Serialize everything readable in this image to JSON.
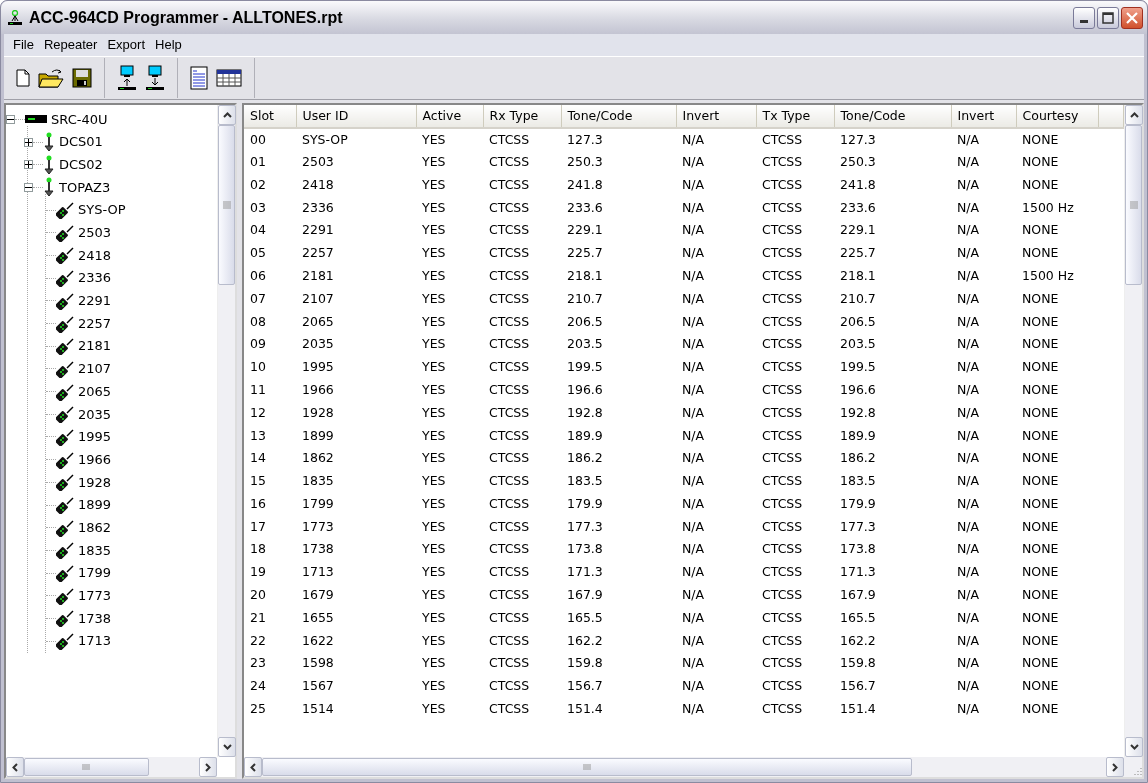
{
  "window": {
    "title": "ACC-964CD Programmer - ALLTONES.rpt"
  },
  "menu": [
    "File",
    "Repeater",
    "Export",
    "Help"
  ],
  "tree": [
    {
      "label": "SRC-40U",
      "kind": "controller",
      "expanded": true,
      "children": [
        {
          "label": "DCS01",
          "kind": "repeater",
          "expanded": false
        },
        {
          "label": "DCS02",
          "kind": "repeater",
          "expanded": false
        },
        {
          "label": "TOPAZ3",
          "kind": "repeater",
          "expanded": true,
          "children": [
            {
              "label": "SYS-OP",
              "kind": "radio"
            },
            {
              "label": "2503",
              "kind": "radio"
            },
            {
              "label": "2418",
              "kind": "radio"
            },
            {
              "label": "2336",
              "kind": "radio"
            },
            {
              "label": "2291",
              "kind": "radio"
            },
            {
              "label": "2257",
              "kind": "radio"
            },
            {
              "label": "2181",
              "kind": "radio"
            },
            {
              "label": "2107",
              "kind": "radio"
            },
            {
              "label": "2065",
              "kind": "radio"
            },
            {
              "label": "2035",
              "kind": "radio"
            },
            {
              "label": "1995",
              "kind": "radio"
            },
            {
              "label": "1966",
              "kind": "radio"
            },
            {
              "label": "1928",
              "kind": "radio"
            },
            {
              "label": "1899",
              "kind": "radio"
            },
            {
              "label": "1862",
              "kind": "radio"
            },
            {
              "label": "1835",
              "kind": "radio"
            },
            {
              "label": "1799",
              "kind": "radio"
            },
            {
              "label": "1773",
              "kind": "radio"
            },
            {
              "label": "1738",
              "kind": "radio"
            },
            {
              "label": "1713",
              "kind": "radio"
            }
          ]
        }
      ]
    }
  ],
  "table": {
    "columns": [
      "Slot",
      "User ID",
      "Active",
      "Rx Type",
      "Tone/Code",
      "Invert",
      "Tx Type",
      "Tone/Code",
      "Invert",
      "Courtesy"
    ],
    "rows": [
      [
        "00",
        "SYS-OP",
        "YES",
        "CTCSS",
        "127.3",
        "N/A",
        "CTCSS",
        "127.3",
        "N/A",
        "NONE"
      ],
      [
        "01",
        "2503",
        "YES",
        "CTCSS",
        "250.3",
        "N/A",
        "CTCSS",
        "250.3",
        "N/A",
        "NONE"
      ],
      [
        "02",
        "2418",
        "YES",
        "CTCSS",
        "241.8",
        "N/A",
        "CTCSS",
        "241.8",
        "N/A",
        "NONE"
      ],
      [
        "03",
        "2336",
        "YES",
        "CTCSS",
        "233.6",
        "N/A",
        "CTCSS",
        "233.6",
        "N/A",
        "1500 Hz"
      ],
      [
        "04",
        "2291",
        "YES",
        "CTCSS",
        "229.1",
        "N/A",
        "CTCSS",
        "229.1",
        "N/A",
        "NONE"
      ],
      [
        "05",
        "2257",
        "YES",
        "CTCSS",
        "225.7",
        "N/A",
        "CTCSS",
        "225.7",
        "N/A",
        "NONE"
      ],
      [
        "06",
        "2181",
        "YES",
        "CTCSS",
        "218.1",
        "N/A",
        "CTCSS",
        "218.1",
        "N/A",
        "1500 Hz"
      ],
      [
        "07",
        "2107",
        "YES",
        "CTCSS",
        "210.7",
        "N/A",
        "CTCSS",
        "210.7",
        "N/A",
        "NONE"
      ],
      [
        "08",
        "2065",
        "YES",
        "CTCSS",
        "206.5",
        "N/A",
        "CTCSS",
        "206.5",
        "N/A",
        "NONE"
      ],
      [
        "09",
        "2035",
        "YES",
        "CTCSS",
        "203.5",
        "N/A",
        "CTCSS",
        "203.5",
        "N/A",
        "NONE"
      ],
      [
        "10",
        "1995",
        "YES",
        "CTCSS",
        "199.5",
        "N/A",
        "CTCSS",
        "199.5",
        "N/A",
        "NONE"
      ],
      [
        "11",
        "1966",
        "YES",
        "CTCSS",
        "196.6",
        "N/A",
        "CTCSS",
        "196.6",
        "N/A",
        "NONE"
      ],
      [
        "12",
        "1928",
        "YES",
        "CTCSS",
        "192.8",
        "N/A",
        "CTCSS",
        "192.8",
        "N/A",
        "NONE"
      ],
      [
        "13",
        "1899",
        "YES",
        "CTCSS",
        "189.9",
        "N/A",
        "CTCSS",
        "189.9",
        "N/A",
        "NONE"
      ],
      [
        "14",
        "1862",
        "YES",
        "CTCSS",
        "186.2",
        "N/A",
        "CTCSS",
        "186.2",
        "N/A",
        "NONE"
      ],
      [
        "15",
        "1835",
        "YES",
        "CTCSS",
        "183.5",
        "N/A",
        "CTCSS",
        "183.5",
        "N/A",
        "NONE"
      ],
      [
        "16",
        "1799",
        "YES",
        "CTCSS",
        "179.9",
        "N/A",
        "CTCSS",
        "179.9",
        "N/A",
        "NONE"
      ],
      [
        "17",
        "1773",
        "YES",
        "CTCSS",
        "177.3",
        "N/A",
        "CTCSS",
        "177.3",
        "N/A",
        "NONE"
      ],
      [
        "18",
        "1738",
        "YES",
        "CTCSS",
        "173.8",
        "N/A",
        "CTCSS",
        "173.8",
        "N/A",
        "NONE"
      ],
      [
        "19",
        "1713",
        "YES",
        "CTCSS",
        "171.3",
        "N/A",
        "CTCSS",
        "171.3",
        "N/A",
        "NONE"
      ],
      [
        "20",
        "1679",
        "YES",
        "CTCSS",
        "167.9",
        "N/A",
        "CTCSS",
        "167.9",
        "N/A",
        "NONE"
      ],
      [
        "21",
        "1655",
        "YES",
        "CTCSS",
        "165.5",
        "N/A",
        "CTCSS",
        "165.5",
        "N/A",
        "NONE"
      ],
      [
        "22",
        "1622",
        "YES",
        "CTCSS",
        "162.2",
        "N/A",
        "CTCSS",
        "162.2",
        "N/A",
        "NONE"
      ],
      [
        "23",
        "1598",
        "YES",
        "CTCSS",
        "159.8",
        "N/A",
        "CTCSS",
        "159.8",
        "N/A",
        "NONE"
      ],
      [
        "24",
        "1567",
        "YES",
        "CTCSS",
        "156.7",
        "N/A",
        "CTCSS",
        "156.7",
        "N/A",
        "NONE"
      ],
      [
        "25",
        "1514",
        "YES",
        "CTCSS",
        "151.4",
        "N/A",
        "CTCSS",
        "151.4",
        "N/A",
        "NONE"
      ]
    ]
  }
}
